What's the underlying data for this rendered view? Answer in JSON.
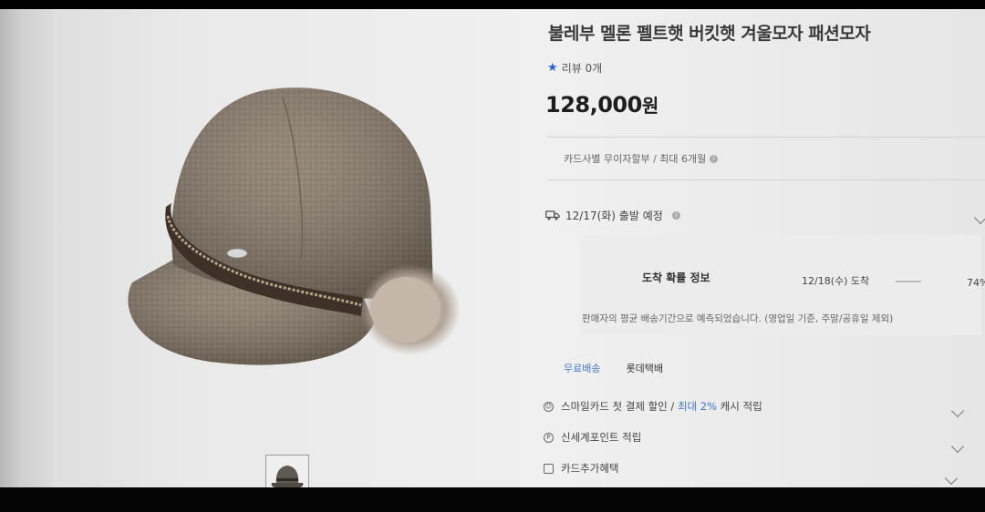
{
  "product": {
    "title": "불레부 멜론 펠트햇 버킷햇 겨울모자 패션모자",
    "review_label": "리뷰 0개",
    "price": "128,000",
    "price_unit": "원"
  },
  "card_installment": {
    "text": "카드사별 무이자할부 / 최대 6개월"
  },
  "shipping": {
    "departure": "12/17(화) 출발 예정",
    "arrival_title": "도착 확률 정보",
    "arrival_date": "12/18(수) 도착",
    "arrival_probability": "74%",
    "notice": "판매자의 평균 배송기간으로 예측되었습니다. (영업일 기준, 주말/공휴일 제외)",
    "free_shipping": "무료배송",
    "courier": "롯데택배"
  },
  "benefits": [
    {
      "icon": "smile-card-icon",
      "text_before": "스마일카드 첫 결제 할인 / ",
      "highlight": "최대 2%",
      "text_after": " 캐시 적립"
    },
    {
      "icon": "point-icon",
      "text_before": "신세계포인트 적립",
      "highlight": "",
      "text_after": ""
    },
    {
      "icon": "card-icon",
      "text_before": "카드추가혜택",
      "highlight": "",
      "text_after": ""
    }
  ],
  "colors": {
    "accent_blue": "#2b62d8",
    "link_blue": "#4a78c9",
    "hat_felt": "#8a7c6f"
  }
}
